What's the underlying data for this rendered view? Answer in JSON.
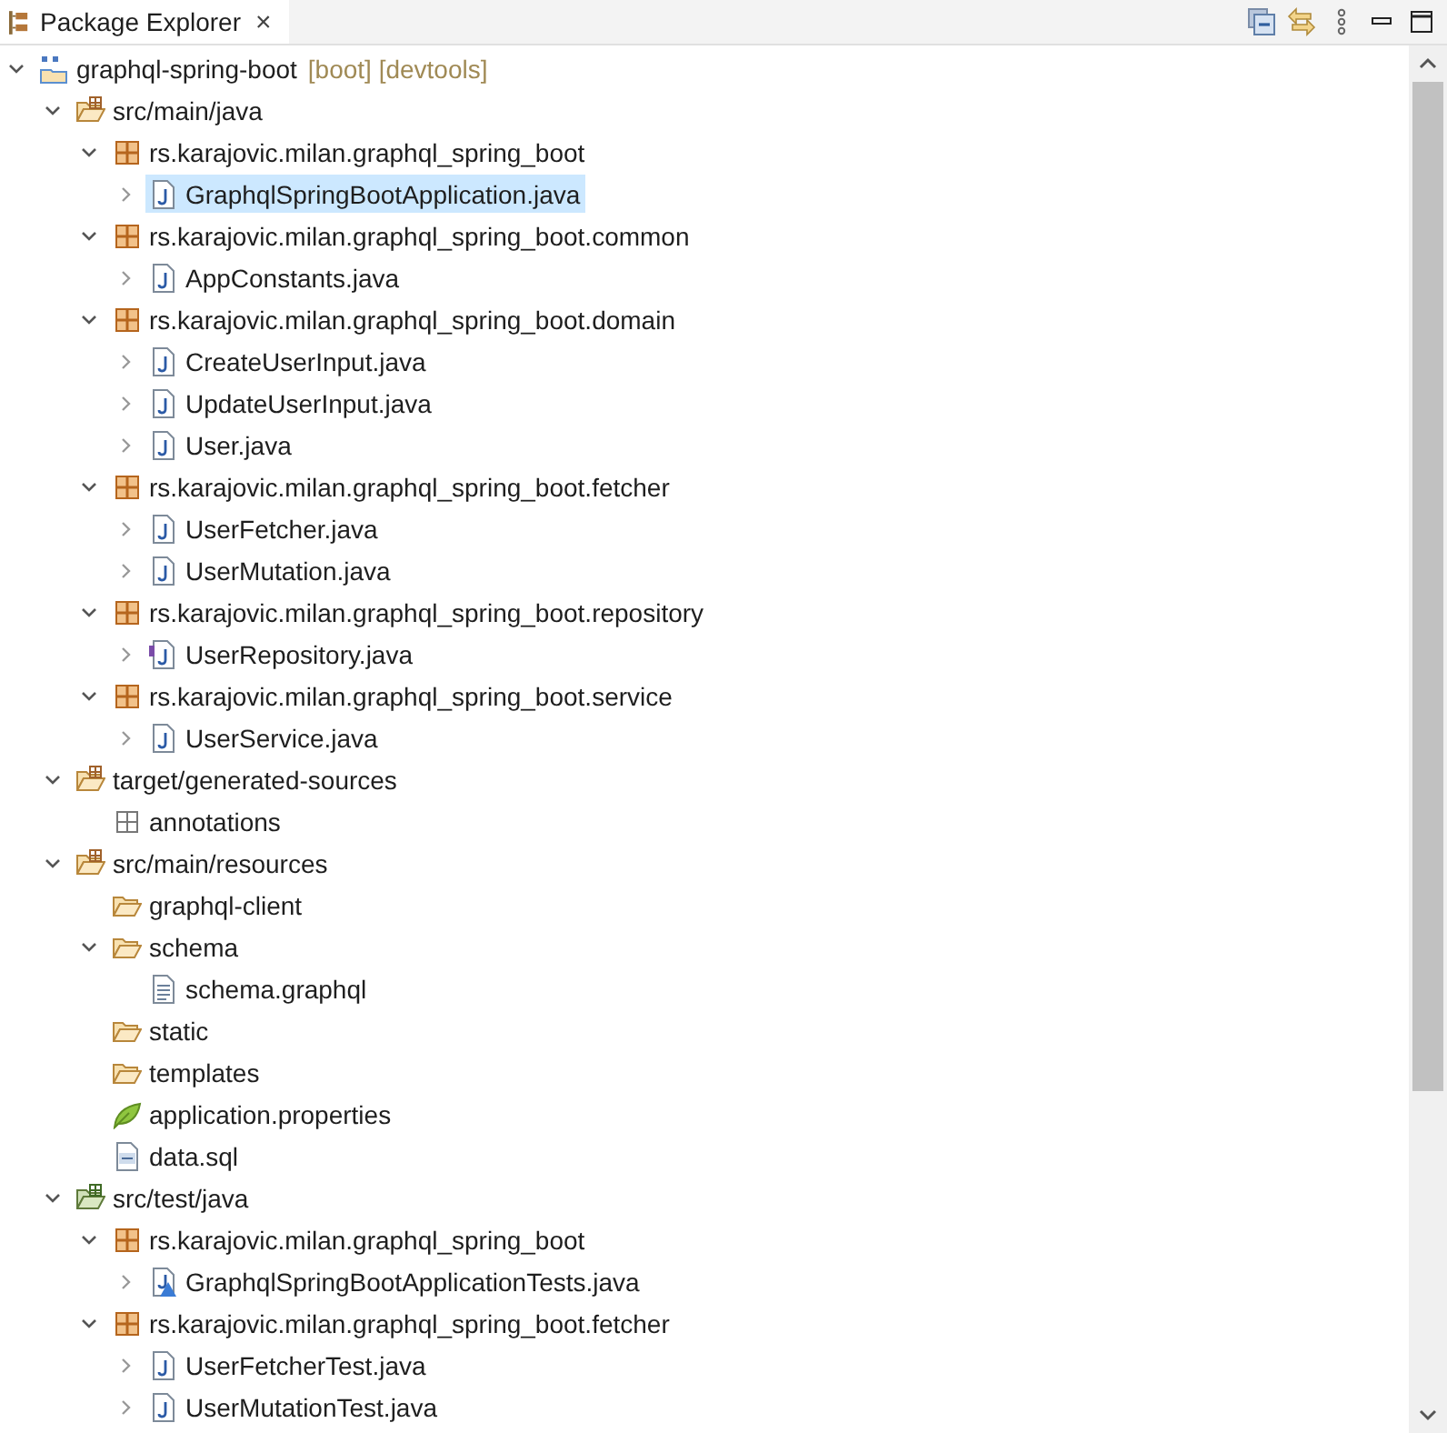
{
  "view": {
    "title": "Package Explorer",
    "close": "×"
  },
  "tree": [
    {
      "kind": "project",
      "label": "graphql-spring-boot",
      "decoration": "[boot] [devtools]",
      "expanded": true,
      "selected": false,
      "children": [
        {
          "kind": "source-folder",
          "label": "src/main/java",
          "expanded": true,
          "selected": false,
          "children": [
            {
              "kind": "package",
              "label": "rs.karajovic.milan.graphql_spring_boot",
              "expanded": true,
              "selected": false,
              "children": [
                {
                  "kind": "java-file",
                  "label": "GraphqlSpringBootApplication.java",
                  "expanded": false,
                  "selected": true
                }
              ]
            },
            {
              "kind": "package",
              "label": "rs.karajovic.milan.graphql_spring_boot.common",
              "expanded": true,
              "selected": false,
              "children": [
                {
                  "kind": "java-file",
                  "label": "AppConstants.java",
                  "expanded": false,
                  "selected": false
                }
              ]
            },
            {
              "kind": "package",
              "label": "rs.karajovic.milan.graphql_spring_boot.domain",
              "expanded": true,
              "selected": false,
              "children": [
                {
                  "kind": "java-file",
                  "label": "CreateUserInput.java",
                  "expanded": false,
                  "selected": false
                },
                {
                  "kind": "java-file",
                  "label": "UpdateUserInput.java",
                  "expanded": false,
                  "selected": false
                },
                {
                  "kind": "java-file",
                  "label": "User.java",
                  "expanded": false,
                  "selected": false
                }
              ]
            },
            {
              "kind": "package",
              "label": "rs.karajovic.milan.graphql_spring_boot.fetcher",
              "expanded": true,
              "selected": false,
              "children": [
                {
                  "kind": "java-file",
                  "label": "UserFetcher.java",
                  "expanded": false,
                  "selected": false
                },
                {
                  "kind": "java-file",
                  "label": "UserMutation.java",
                  "expanded": false,
                  "selected": false
                }
              ]
            },
            {
              "kind": "package",
              "label": "rs.karajovic.milan.graphql_spring_boot.repository",
              "expanded": true,
              "selected": false,
              "children": [
                {
                  "kind": "interface-file",
                  "label": "UserRepository.java",
                  "expanded": false,
                  "selected": false
                }
              ]
            },
            {
              "kind": "package",
              "label": "rs.karajovic.milan.graphql_spring_boot.service",
              "expanded": true,
              "selected": false,
              "children": [
                {
                  "kind": "java-file",
                  "label": "UserService.java",
                  "expanded": false,
                  "selected": false
                }
              ]
            }
          ]
        },
        {
          "kind": "source-folder",
          "label": "target/generated-sources",
          "expanded": true,
          "selected": false,
          "children": [
            {
              "kind": "empty-package",
              "label": "annotations",
              "selected": false
            }
          ]
        },
        {
          "kind": "source-folder",
          "label": "src/main/resources",
          "expanded": true,
          "selected": false,
          "children": [
            {
              "kind": "folder",
              "label": "graphql-client",
              "selected": false
            },
            {
              "kind": "folder",
              "label": "schema",
              "expanded": true,
              "selected": false,
              "children": [
                {
                  "kind": "text-file",
                  "label": "schema.graphql",
                  "selected": false
                }
              ]
            },
            {
              "kind": "folder",
              "label": "static",
              "selected": false
            },
            {
              "kind": "folder",
              "label": "templates",
              "selected": false
            },
            {
              "kind": "properties-file",
              "label": "application.properties",
              "selected": false
            },
            {
              "kind": "sql-file",
              "label": "data.sql",
              "selected": false
            }
          ]
        },
        {
          "kind": "test-folder",
          "label": "src/test/java",
          "expanded": true,
          "selected": false,
          "children": [
            {
              "kind": "package",
              "label": "rs.karajovic.milan.graphql_spring_boot",
              "expanded": true,
              "selected": false,
              "children": [
                {
                  "kind": "test-file",
                  "label": "GraphqlSpringBootApplicationTests.java",
                  "expanded": false,
                  "selected": false
                }
              ]
            },
            {
              "kind": "package",
              "label": "rs.karajovic.milan.graphql_spring_boot.fetcher",
              "expanded": true,
              "selected": false,
              "children": [
                {
                  "kind": "java-file",
                  "label": "UserFetcherTest.java",
                  "expanded": false,
                  "selected": false
                },
                {
                  "kind": "java-file",
                  "label": "UserMutationTest.java",
                  "expanded": false,
                  "selected": false
                }
              ]
            }
          ]
        }
      ]
    }
  ]
}
